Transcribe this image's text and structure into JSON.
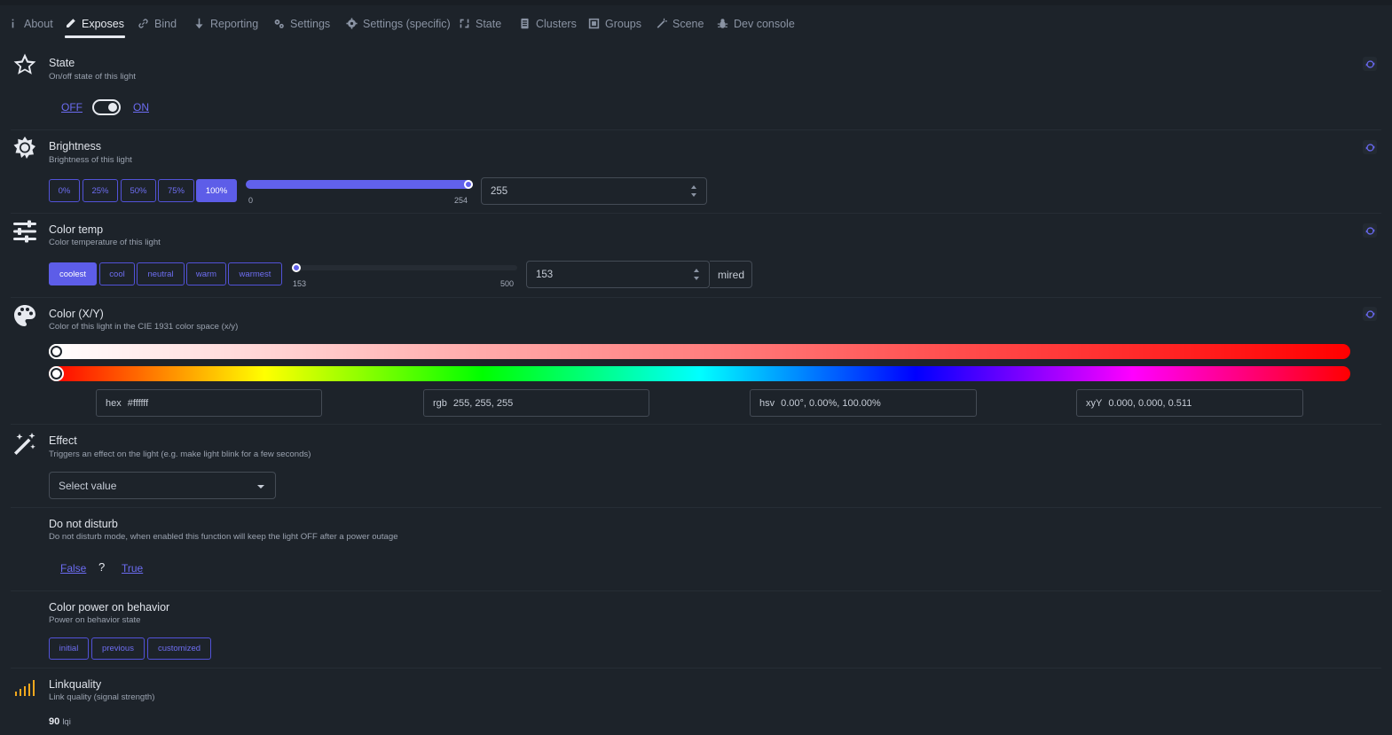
{
  "tabs": [
    {
      "label": "About",
      "icon": "info-icon"
    },
    {
      "label": "Exposes",
      "icon": "pencil-icon"
    },
    {
      "label": "Bind",
      "icon": "link-icon"
    },
    {
      "label": "Reporting",
      "icon": "arrow-down-icon"
    },
    {
      "label": "Settings",
      "icon": "gears-icon"
    },
    {
      "label": "Settings (specific)",
      "icon": "gear-icon"
    },
    {
      "label": "State",
      "icon": "sync-icon"
    },
    {
      "label": "Clusters",
      "icon": "list-icon"
    },
    {
      "label": "Groups",
      "icon": "group-icon"
    },
    {
      "label": "Scene",
      "icon": "wand-icon"
    },
    {
      "label": "Dev console",
      "icon": "bug-icon"
    }
  ],
  "active_tab": "Exposes",
  "state": {
    "title": "State",
    "desc": "On/off state of this light",
    "off_label": "OFF",
    "on_label": "ON",
    "value": "ON",
    "icon": "star-icon"
  },
  "brightness": {
    "title": "Brightness",
    "desc": "Brightness of this light",
    "presets": [
      "0%",
      "25%",
      "50%",
      "75%",
      "100%"
    ],
    "active_preset": "100%",
    "min_label": "0",
    "max_label": "254",
    "min": 0,
    "max": 254,
    "value": 254,
    "input_value": "255",
    "icon": "sun-icon"
  },
  "color_temp": {
    "title": "Color temp",
    "desc": "Color temperature of this light",
    "presets": [
      "coolest",
      "cool",
      "neutral",
      "warm",
      "warmest"
    ],
    "active_preset": "coolest",
    "min_label": "153",
    "max_label": "500",
    "min": 153,
    "max": 500,
    "value": 153,
    "input_value": "153",
    "unit": "mired",
    "icon": "sliders-icon"
  },
  "color_xy": {
    "title": "Color (X/Y)",
    "desc": "Color of this light in the CIE 1931 color space (x/y)",
    "saturation_value": 0,
    "hue_value": 0,
    "hex_label": "hex",
    "hex_value": "#ffffff",
    "rgb_label": "rgb",
    "rgb_value": "255, 255, 255",
    "hsv_label": "hsv",
    "hsv_value": "0.00°, 0.00%, 100.00%",
    "xyy_label": "xyY",
    "xyy_value": "0.000, 0.000, 0.511",
    "icon": "palette-icon"
  },
  "effect": {
    "title": "Effect",
    "desc": "Triggers an effect on the light (e.g. make light blink for a few seconds)",
    "select_value": "Select value",
    "icon": "magic-wand-icon"
  },
  "do_not_disturb": {
    "title": "Do not disturb",
    "desc": "Do not disturb mode, when enabled this function will keep the light OFF after a power outage",
    "false_label": "False",
    "unknown_label": "?",
    "true_label": "True"
  },
  "power_on_behavior": {
    "title": "Color power on behavior",
    "desc": "Power on behavior state",
    "options": [
      "initial",
      "previous",
      "customized"
    ]
  },
  "linkquality": {
    "title": "Linkquality",
    "desc": "Link quality (signal strength)",
    "value": "90",
    "unit": "lqi",
    "icon": "signal-icon"
  },
  "colors": {
    "accent": "#6161ec",
    "background": "#1d232a",
    "signal": "#f2a81d"
  }
}
